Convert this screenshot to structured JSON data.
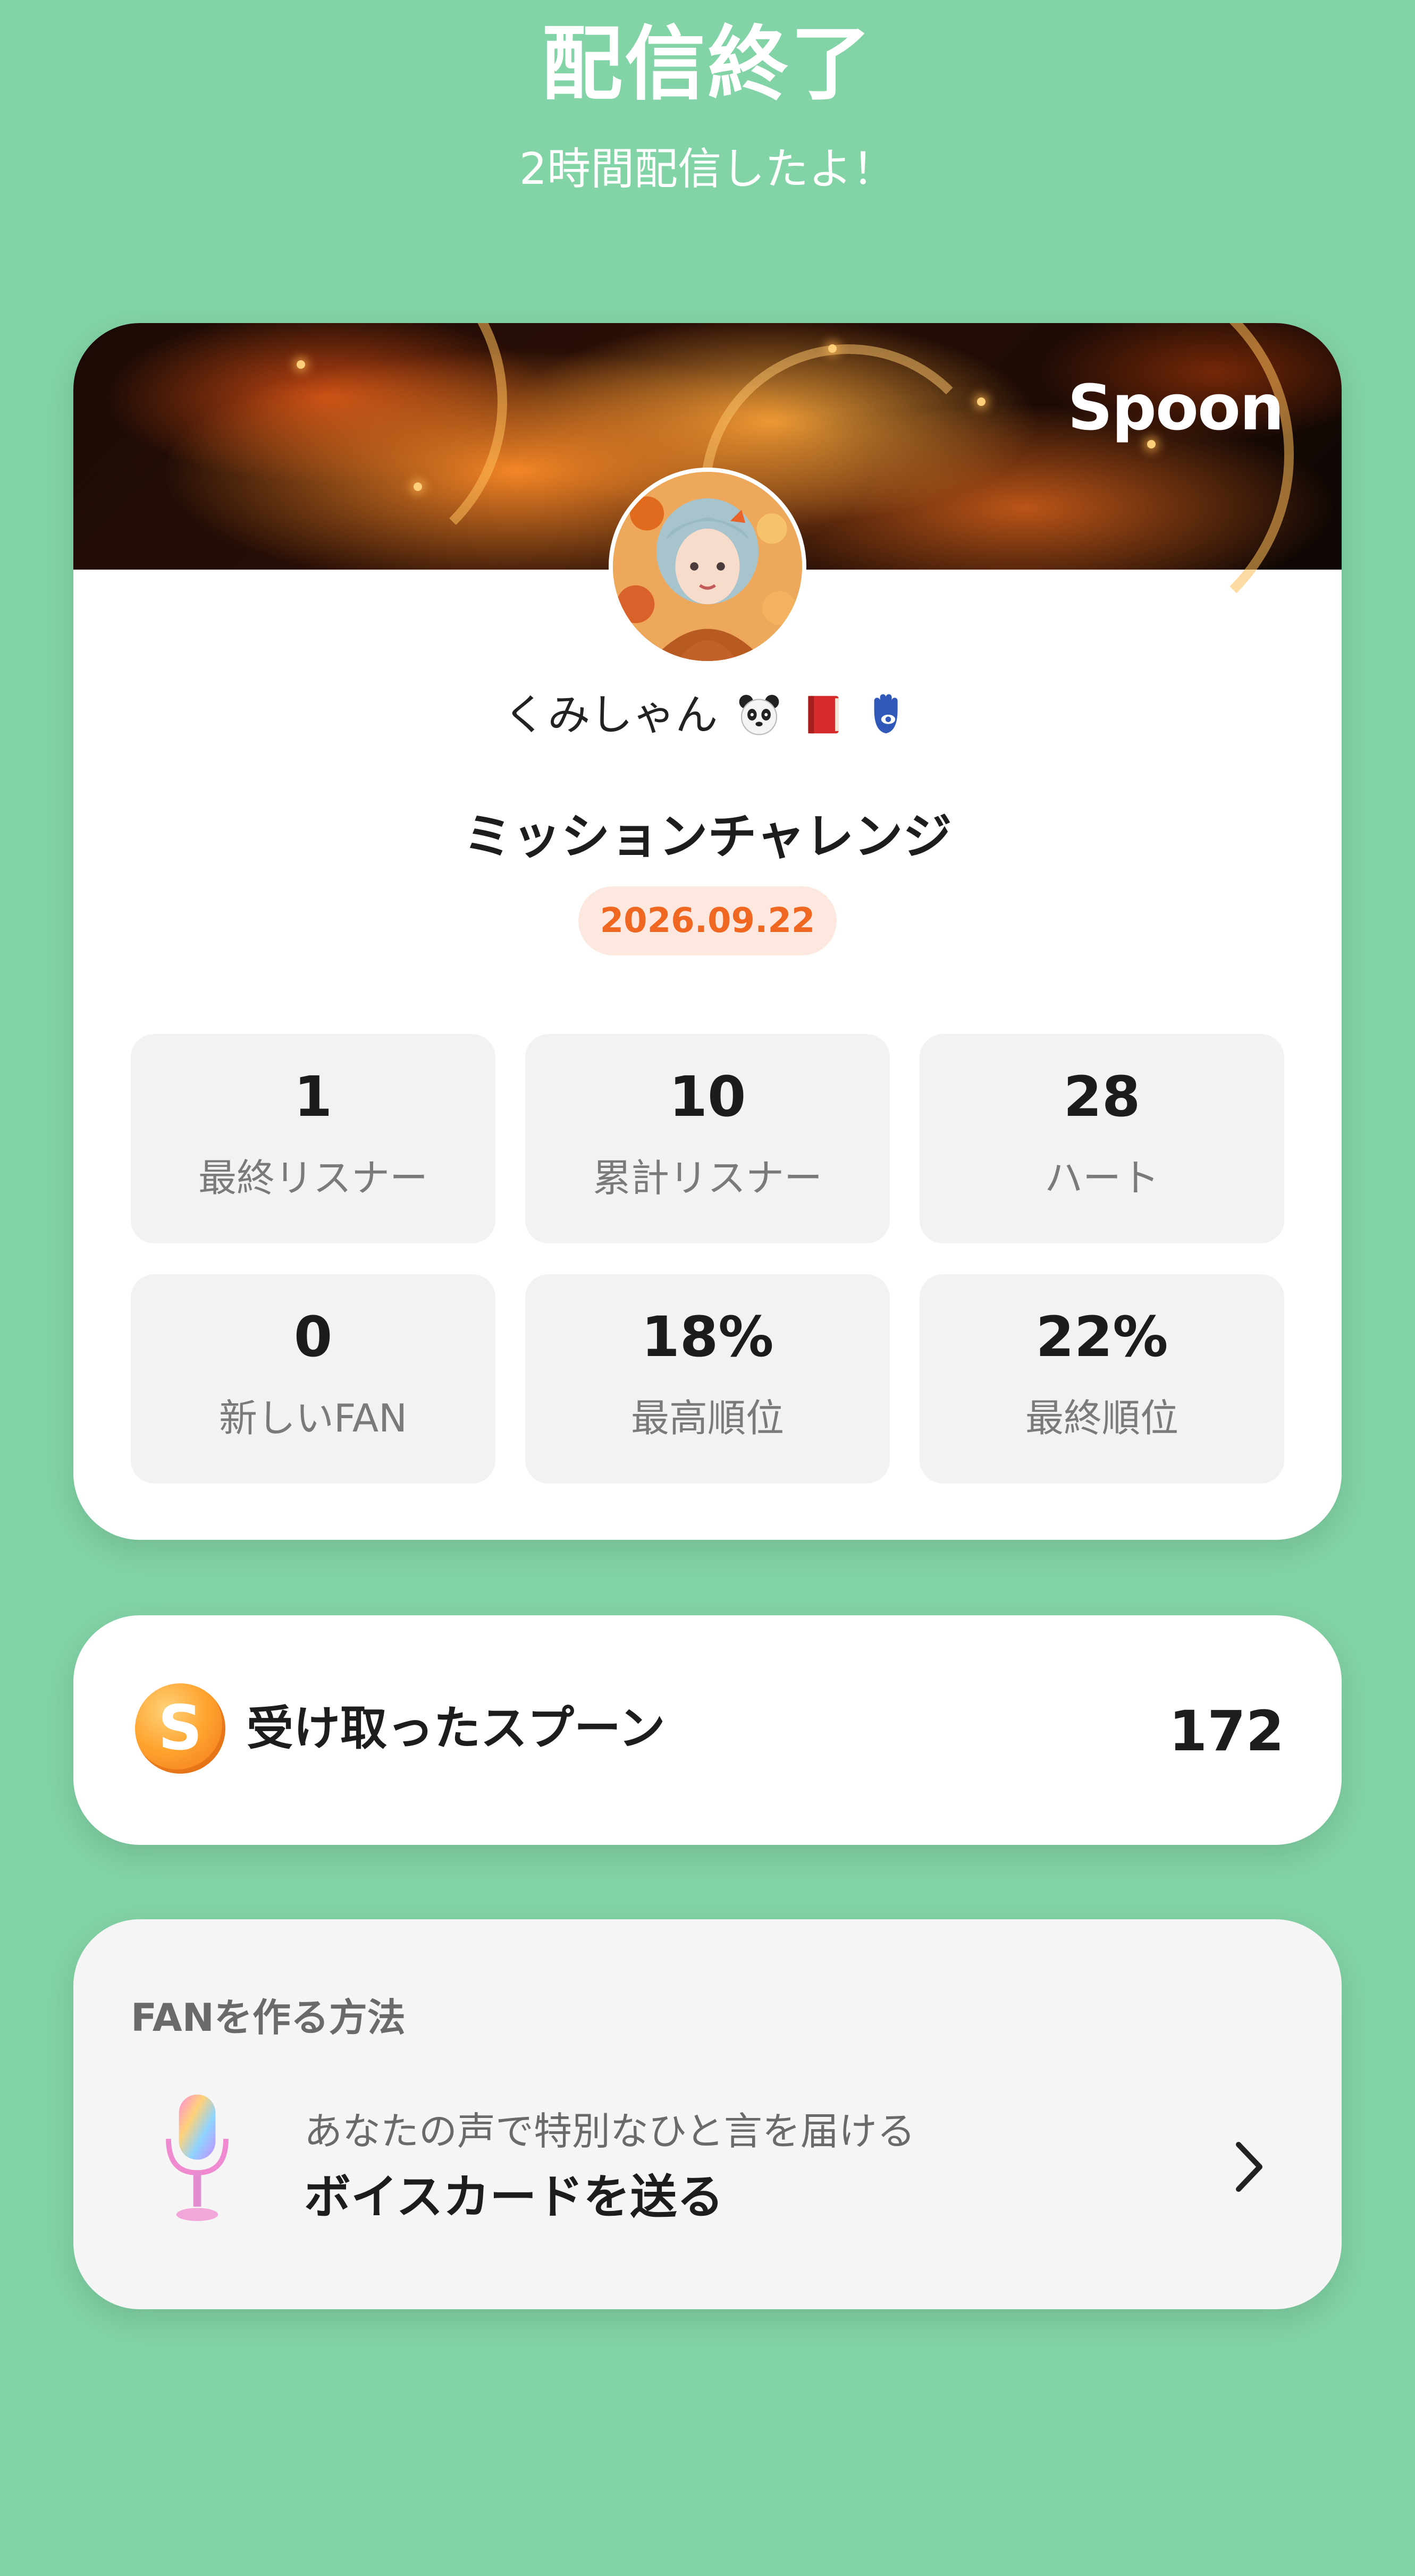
{
  "header": {
    "title": "配信終了",
    "subtitle": "2時間配信したよ！"
  },
  "summary_card": {
    "brand": "Spoon",
    "user_name": "くみしゃん",
    "user_emojis": [
      "panda-face",
      "red-book",
      "hamsa"
    ],
    "mission_title": "ミッションチャレンジ",
    "date": "2026.09.22",
    "stats": [
      {
        "value": "1",
        "label": "最終リスナー"
      },
      {
        "value": "10",
        "label": "累計リスナー"
      },
      {
        "value": "28",
        "label": "ハート"
      },
      {
        "value": "0",
        "label": "新しいFAN"
      },
      {
        "value": "18%",
        "label": "最高順位"
      },
      {
        "value": "22%",
        "label": "最終順位"
      }
    ]
  },
  "spoon_card": {
    "icon_letter": "S",
    "label": "受け取ったスプーン",
    "count": "172"
  },
  "fan_card": {
    "heading": "FANを作る方法",
    "description": "あなたの声で特別なひと言を届ける",
    "action": "ボイスカードを送る"
  },
  "colors": {
    "background": "#82d3a5",
    "date_badge_bg": "#fde8df",
    "date_badge_text": "#f06722",
    "coin": "#ffa531"
  }
}
